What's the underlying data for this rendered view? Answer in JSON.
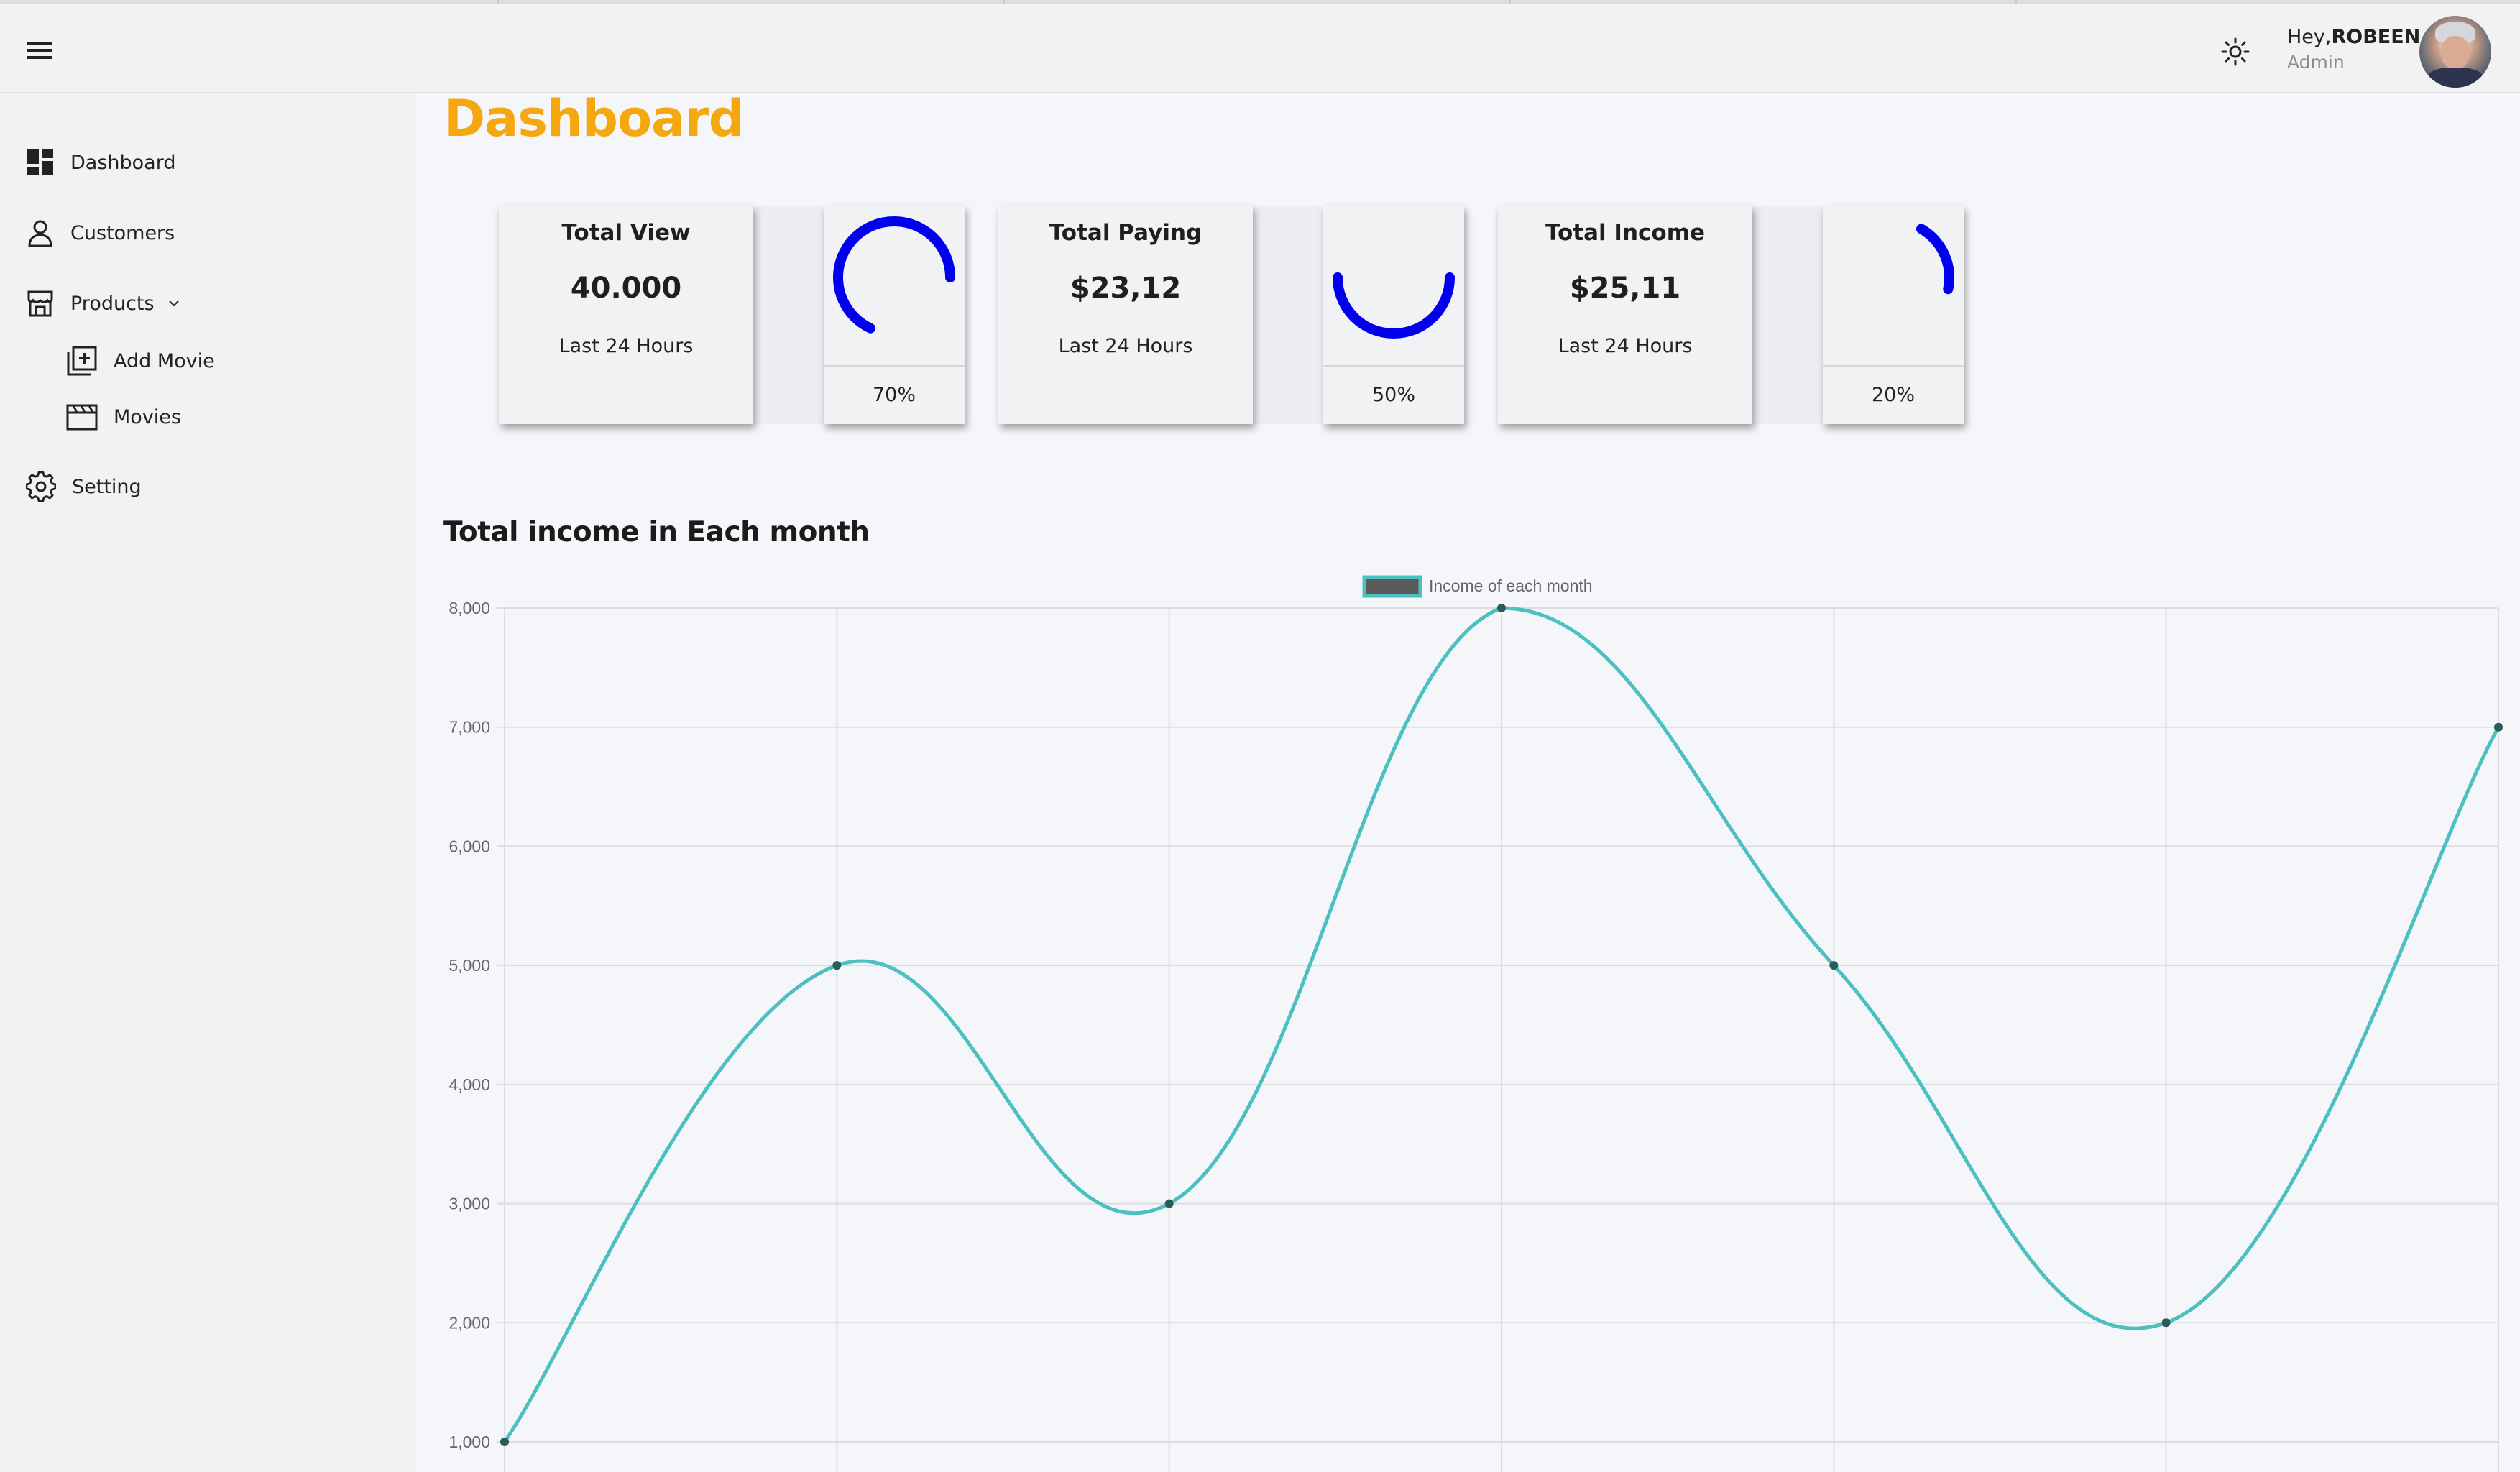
{
  "header": {
    "greeting_prefix": "Hey,",
    "user_name": "ROBEEN",
    "role": "Admin"
  },
  "sidebar": {
    "items": [
      {
        "label": "Dashboard",
        "icon": "dashboard-icon"
      },
      {
        "label": "Customers",
        "icon": "person-icon"
      },
      {
        "label": "Products",
        "icon": "store-icon",
        "expanded": true
      },
      {
        "label": "Add Movie",
        "icon": "add-library-icon"
      },
      {
        "label": "Movies",
        "icon": "clapperboard-icon"
      },
      {
        "label": "Setting",
        "icon": "gear-icon"
      }
    ]
  },
  "page": {
    "title": "Dashboard",
    "section_title": "Total income in Each month"
  },
  "cards": [
    {
      "title": "Total View",
      "value": "40.000",
      "subtitle": "Last 24 Hours",
      "percent_label": "70%",
      "percent": 70
    },
    {
      "title": "Total Paying",
      "value": "$23,12",
      "subtitle": "Last 24 Hours",
      "percent_label": "50%",
      "percent": 50
    },
    {
      "title": "Total Income",
      "value": "$25,11",
      "subtitle": "Last 24 Hours",
      "percent_label": "20%",
      "percent": 20
    }
  ],
  "colors": {
    "brand_title": "#f5a70f",
    "ring": "#0000ee",
    "line": "#4bc0c0",
    "point": "#2a5c5a",
    "legend_fill": "#5a5a5a"
  },
  "chart_data": {
    "type": "line",
    "title": "",
    "xlabel": "",
    "ylabel": "",
    "legend": "top-center",
    "grid": true,
    "series": [
      {
        "name": "Income of each month",
        "values": [
          1000,
          5000,
          3000,
          8000,
          5000,
          2000,
          7000
        ]
      }
    ],
    "ylim": [
      1000,
      8000
    ],
    "yticks": [
      "8,000",
      "7,000",
      "6,000",
      "5,000",
      "4,000",
      "3,000",
      "2,000",
      "1,000"
    ]
  }
}
